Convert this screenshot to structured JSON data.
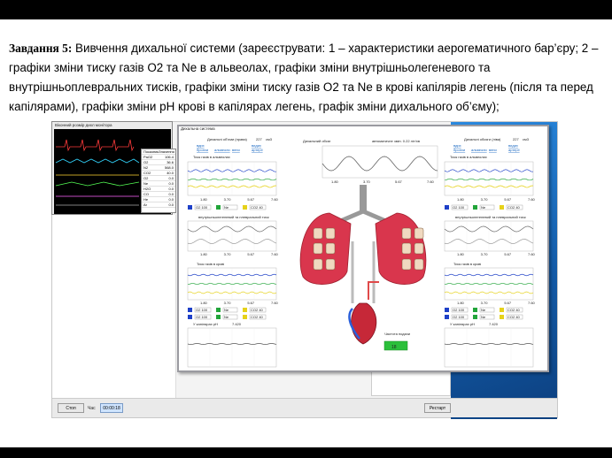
{
  "task": {
    "lead": "Завдання 5:",
    "text": " Вивчення дихальної системи (зареєструвати: 1 – характеристики аерогематичного бар’єру; 2 – графіки зміни тиску газів O2 та Ne в альвеолах, графіки зміни внутрішньолегеневого та внутрішньоплевральних тисків, графіки зміни тиску газів O2 та Ne в крові капілярів легень (після та перед капілярами), графіки зміни pH крові в капілярах легень, графік зміни дихального об’єму);"
  },
  "monitor": {
    "title": "Віконний розмір дихл монітора",
    "rows": [
      {
        "k": "Показник",
        "v": "Значення"
      },
      {
        "k": "PaO2",
        "v": "106.4"
      },
      {
        "k": "O2",
        "v": "36.6"
      },
      {
        "k": "N2",
        "v": "568.0"
      },
      {
        "k": "CO2",
        "v": "40.0"
      },
      {
        "k": "O2",
        "v": "0.0"
      },
      {
        "k": "Ne",
        "v": "0.0"
      },
      {
        "k": "H2O",
        "v": "0.0"
      },
      {
        "k": "CO",
        "v": "0.0"
      },
      {
        "k": "He",
        "v": "0.0"
      },
      {
        "k": "Ar",
        "v": "0.0"
      }
    ]
  },
  "sim": {
    "title": "Дихальна система",
    "left": {
      "volume_label": "Дихальні об’єми (права)",
      "volume_value": "227",
      "volume_unit": "см3",
      "links": [
        "вдих",
        "видих",
        "бронхи",
        "альвеоли",
        "вени",
        "артерії"
      ],
      "alv_title": "Тиск газів в альвеолах",
      "pleural_title": "внутрішньолегеневий та плевральний тиск",
      "blood_title": "Тиск газів в крові",
      "ph_title": "У капілярах pH",
      "ph_value": "7.420",
      "ticks": [
        "1.80",
        "3.70",
        "5.67",
        "7.60"
      ],
      "legend_o2": "O2 100",
      "legend_ne": "Ne",
      "legend_co2": "CO2 40"
    },
    "center": {
      "volume_title": "Дихальний обсяг",
      "volume_title2": "автоматичне змін. 0.22 літ/хв",
      "rate_label": "Частота подачи",
      "rate_value": "18"
    },
    "right": {
      "volume_label": "Дихальні обсяги (ліва)",
      "volume_value": "227",
      "volume_unit": "см3",
      "ph_value": "7.420"
    }
  },
  "bg_app": {
    "stop_button": "Стоп",
    "time_label": "Час",
    "time_value": "00:00:18",
    "start_button": "Рестарт"
  }
}
